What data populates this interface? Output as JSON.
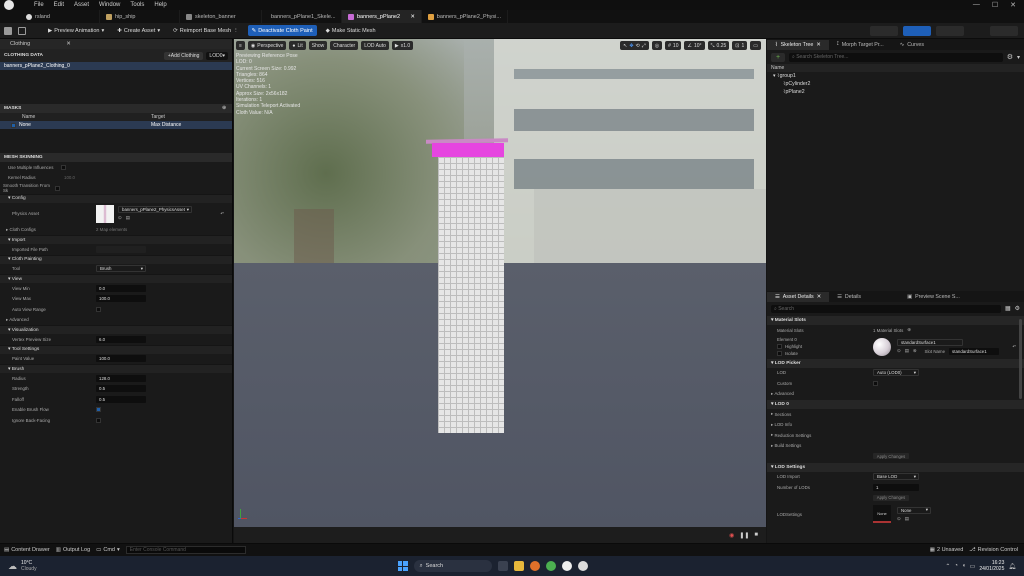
{
  "menu": [
    "File",
    "Edit",
    "Asset",
    "Window",
    "Tools",
    "Help"
  ],
  "project": "rsland",
  "tabs": [
    {
      "label": "hip_ship",
      "color": "#c0a060"
    },
    {
      "label": "skeleton_banner",
      "color": "#7d7d7d"
    },
    {
      "label": "banners_pPlane1_Skele...",
      "color": "#7d7d7d"
    },
    {
      "label": "banners_pPlane2",
      "color": "#c86bd6"
    },
    {
      "label": "banners_pPlane2_Physi...",
      "color": "#e0a040"
    }
  ],
  "toolbar": {
    "preview_animation": "Preview Animation",
    "create_asset": "Create Asset",
    "reimport": "Reimport Base Mesh",
    "deactivate": "Deactivate Cloth Paint",
    "make_static": "Make Static Mesh"
  },
  "left": {
    "tab": "Clothing",
    "clothing_data_label": "CLOTHING DATA",
    "add_clothing": "Add Clothing",
    "lod_select": "LOD0",
    "clothing_item": "banners_pPlane2_Clothing_0",
    "masks_label": "MASKS",
    "mask_col_name": "Name",
    "mask_col_target": "Target",
    "mask_name": "None",
    "mask_target": "Max Distance",
    "mesh_skinning": "MESH SKINNING",
    "use_multiple": "Use Multiple Influences",
    "kernel_radius": "Kernel Radius",
    "kernel_radius_value": "100.0",
    "smooth_transition": "Smooth Transition From Sk",
    "config": "Config",
    "physics_asset": "Physics Asset",
    "physics_asset_value": "banners_pPlane2_PhysicsAsset",
    "cloth_configs": "Cloth Configs",
    "cloth_configs_value": "2 Map elements",
    "import": "Import",
    "imported_file_path": "Imported File Path",
    "cloth_painting": "Cloth Painting",
    "tool": "Tool",
    "tool_value": "Brush",
    "view": "View",
    "view_min": "View Min",
    "view_min_value": "0.0",
    "view_max": "View Max",
    "view_max_value": "100.0",
    "auto_view_range": "Auto View Range",
    "advanced": "Advanced",
    "visualization": "Visualization",
    "vertex_preview": "Vertex Preview Size",
    "vertex_preview_value": "6.0",
    "tool_settings": "Tool Settings",
    "paint_value": "Paint Value",
    "paint_value_value": "100.0",
    "brush": "Brush",
    "radius": "Radius",
    "radius_value": "128.0",
    "strength": "Strength",
    "strength_value": "0.5",
    "falloff": "Falloff",
    "falloff_value": "0.5",
    "enable_brush_flow": "Enable Brush Flow",
    "ignore_back": "Ignore Back-Facing"
  },
  "viewport": {
    "perspective": "Perspective",
    "lit": "Lit",
    "show": "Show",
    "character": "Character",
    "lod_auto": "LOD Auto",
    "speed": "x1.0",
    "snap_grid": "10",
    "snap_angle": "10°",
    "snap_scale": "0.25",
    "camera_speed": "1",
    "stats": [
      "Previewing Reference Pose",
      "LOD: 0",
      "Current Screen Size: 0.992",
      "Triangles: 864",
      "Vertices: 516",
      "UV Channels: 1",
      "Approx Size: 2x56x182",
      "Iterations: 1",
      "Simulation Teleport Activated",
      "Cloth Value: N/A"
    ]
  },
  "skeleton": {
    "tabs": [
      "Skeleton Tree",
      "Morph Target Pr...",
      "Curves"
    ],
    "search_placeholder": "Search Skeleton Tree...",
    "name_header": "Name",
    "tree": [
      "group1",
      "pCylinder2",
      "pPlane2"
    ]
  },
  "details": {
    "tabs": [
      "Asset Details",
      "Details",
      "Preview Scene S..."
    ],
    "search_placeholder": "Search",
    "material_slots": "Material Slots",
    "material_slots_label": "Material Slots",
    "material_slots_value": "1 Material Slots",
    "element0": "Element 0",
    "highlight": "Highlight",
    "isolate": "Isolate",
    "material_name": "standardSurface1",
    "slot_name_label": "Slot Name",
    "slot_name_value": "standardSurface1",
    "lod_picker": "LOD Picker",
    "lod": "LOD",
    "lod_value": "Auto (LOD0)",
    "custom": "Custom",
    "advanced": "Advanced",
    "lod0": "LOD 0",
    "sections": "Sections",
    "lod_info": "LOD Info",
    "reduction": "Reduction Settings",
    "build": "Build Settings",
    "apply_changes": "Apply Changes",
    "lod_settings": "LOD Settings",
    "lod_import": "LOD Import",
    "lod_import_value": "Base LOD",
    "num_lods": "Number of LODs",
    "num_lods_value": "1",
    "apply_changes2": "Apply Changes",
    "lodsettings": "LODSettings",
    "lodsettings_value": "None",
    "thumb_label": "None"
  },
  "statusbar": {
    "content_drawer": "Content Drawer",
    "output_log": "Output Log",
    "cmd": "Cmd",
    "console_placeholder": "Enter Console Command",
    "unsaved": "2 Unsaved",
    "revision": "Revision Control"
  },
  "taskbar": {
    "temp": "10°C",
    "weather": "Cloudy",
    "search": "Search",
    "time": "16:23",
    "date": "24/01/2025"
  }
}
